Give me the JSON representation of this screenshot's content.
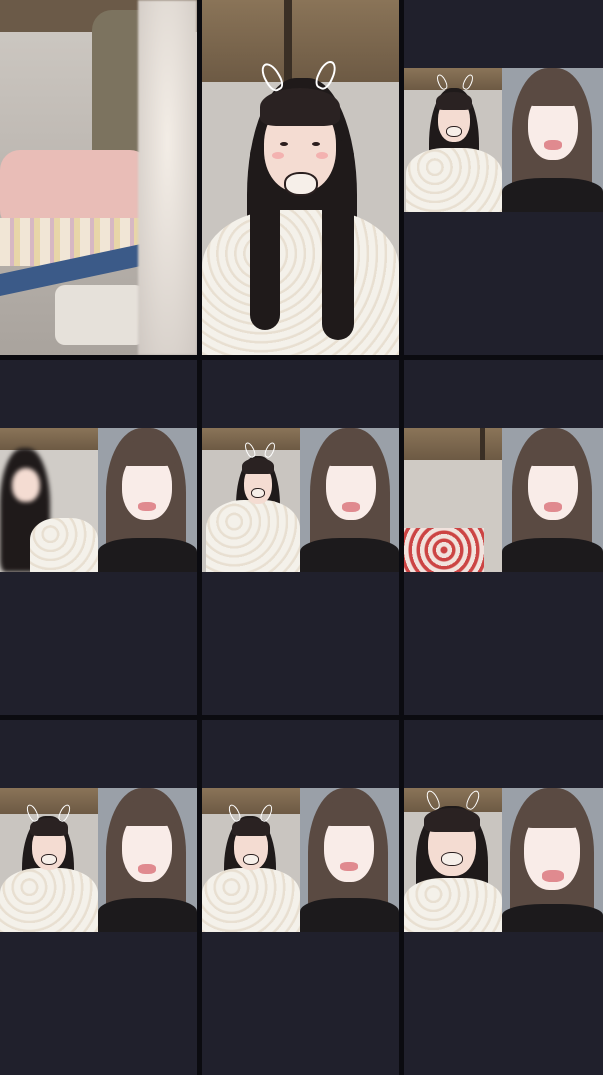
{
  "layout": {
    "rows": 3,
    "cols": 3
  },
  "cells": [
    {
      "id": "cell-1",
      "kind": "room-blur"
    },
    {
      "id": "cell-2",
      "kind": "single-portrait",
      "effect": "bunny-ears"
    },
    {
      "id": "cell-3",
      "kind": "split-duet",
      "effect": "bunny-ears"
    },
    {
      "id": "cell-4",
      "kind": "split-duet",
      "effect": "none"
    },
    {
      "id": "cell-5",
      "kind": "split-duet",
      "effect": "bunny-ears"
    },
    {
      "id": "cell-6",
      "kind": "split-duet",
      "effect": "none"
    },
    {
      "id": "cell-7",
      "kind": "split-duet",
      "effect": "bunny-ears"
    },
    {
      "id": "cell-8",
      "kind": "split-duet",
      "effect": "bunny-ears"
    },
    {
      "id": "cell-9",
      "kind": "split-duet",
      "effect": "bunny-ears"
    }
  ],
  "colors": {
    "background": "#0b0b10",
    "cell_bg": "#20202c",
    "hair": "#1f1a1a",
    "skin": "#f4dcd2",
    "lips": "#e08a8f"
  }
}
